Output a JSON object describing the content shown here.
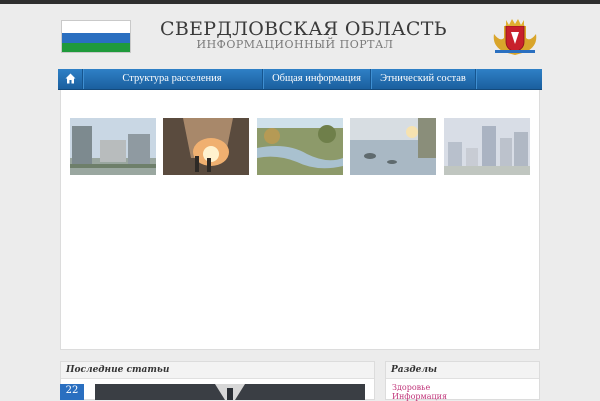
{
  "header": {
    "title": "СВЕРДЛОВСКАЯ ОБЛАСТЬ",
    "subtitle": "ИНФОРМАЦИОННЫЙ ПОРТАЛ"
  },
  "nav": {
    "items": [
      {
        "label": "Структура расселения"
      },
      {
        "label": "Общая информация"
      },
      {
        "label": "Этнический состав"
      }
    ]
  },
  "slider": {
    "thumbnails": [
      "city-photo",
      "steel-mill-photo",
      "river-forest-photo",
      "lake-sunset-photo",
      "city-skyline-photo"
    ]
  },
  "latest": {
    "heading": "Последние статьи",
    "date_day": "22"
  },
  "sections": {
    "heading": "Разделы",
    "links": [
      "Здоровье",
      "Информация"
    ]
  },
  "colors": {
    "nav_blue": "#1f6aae",
    "accent_blue": "#2a6fc0",
    "link_pink": "#c0357a"
  }
}
